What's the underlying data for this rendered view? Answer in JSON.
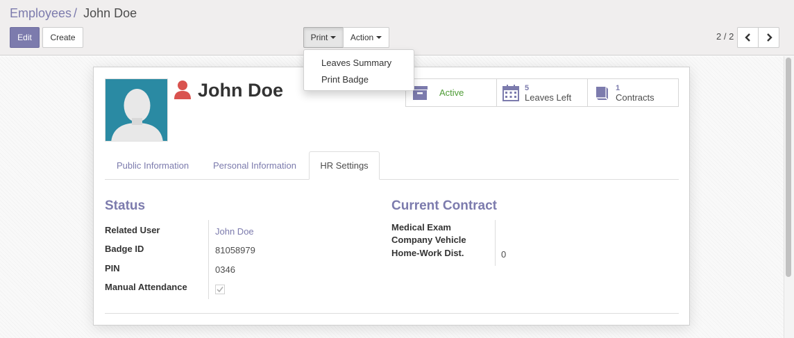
{
  "breadcrumb": {
    "parent": "Employees",
    "separator": "/",
    "current": "John Doe"
  },
  "toolbar": {
    "edit_label": "Edit",
    "create_label": "Create",
    "print_label": "Print",
    "action_label": "Action"
  },
  "pager": {
    "value": "2 / 2",
    "prev_icon": "chevron-left-icon",
    "next_icon": "chevron-right-icon"
  },
  "print_menu": {
    "items": [
      "Leaves Summary",
      "Print Badge"
    ]
  },
  "employee": {
    "name": "John Doe",
    "status_icon_color": "#d9534f"
  },
  "stat_buttons": [
    {
      "icon": "archive-icon",
      "label": "Active",
      "color": "#4d9b34"
    },
    {
      "icon": "calendar-icon",
      "value": "5",
      "label": "Leaves Left"
    },
    {
      "icon": "book-icon",
      "value": "1",
      "label": "Contracts"
    }
  ],
  "tabs": [
    {
      "label": "Public Information",
      "active": false
    },
    {
      "label": "Personal Information",
      "active": false
    },
    {
      "label": "HR Settings",
      "active": true
    }
  ],
  "status_group": {
    "title": "Status",
    "fields": [
      {
        "label": "Related User",
        "value": "John Doe"
      },
      {
        "label": "Badge ID",
        "value": "81058979"
      },
      {
        "label": "PIN",
        "value": "0346"
      },
      {
        "label": "Manual Attendance",
        "checked": true
      }
    ]
  },
  "contract_group": {
    "title": "Current Contract",
    "fields": [
      {
        "label": "Medical Exam",
        "value": ""
      },
      {
        "label": "Company Vehicle",
        "value": ""
      },
      {
        "label": "Home-Work Dist.",
        "value": "0"
      }
    ]
  },
  "colors": {
    "brand": "#7c7bad",
    "avatar_bg": "#2a8aa3",
    "active_green": "#4d9b34"
  }
}
